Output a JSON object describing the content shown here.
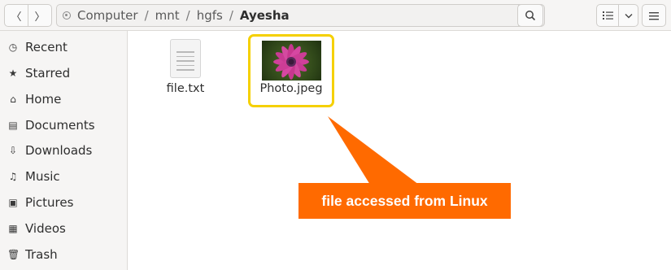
{
  "toolbar": {
    "back_glyph": "〈",
    "forward_glyph": "〉",
    "path_menu_glyph": "⋮",
    "search_glyph": "⌕",
    "view_list_glyph": "☰",
    "view_drop_glyph": "⌄",
    "menu_glyph": "≡"
  },
  "breadcrumb": {
    "items": [
      "Computer",
      "mnt",
      "hgfs",
      "Ayesha"
    ],
    "separator": "/"
  },
  "sidebar": {
    "items": [
      {
        "label": "Recent",
        "icon": "clock-icon",
        "glyph": "◷"
      },
      {
        "label": "Starred",
        "icon": "star-icon",
        "glyph": "★"
      },
      {
        "label": "Home",
        "icon": "home-icon",
        "glyph": "⌂"
      },
      {
        "label": "Documents",
        "icon": "document-icon",
        "glyph": "▤"
      },
      {
        "label": "Downloads",
        "icon": "download-icon",
        "glyph": "⇩"
      },
      {
        "label": "Music",
        "icon": "music-icon",
        "glyph": "♫"
      },
      {
        "label": "Pictures",
        "icon": "picture-icon",
        "glyph": "▣"
      },
      {
        "label": "Videos",
        "icon": "video-icon",
        "glyph": "▦"
      },
      {
        "label": "Trash",
        "icon": "trash-icon",
        "glyph": "🗑"
      }
    ]
  },
  "files": [
    {
      "name": "file.txt",
      "type": "text-file-icon"
    },
    {
      "name": "Photo.jpeg",
      "type": "image-thumbnail",
      "selected": true
    }
  ],
  "annotation": {
    "text": "file accessed from Linux",
    "color": "#ff6a00",
    "highlight_color": "#f5d000"
  }
}
